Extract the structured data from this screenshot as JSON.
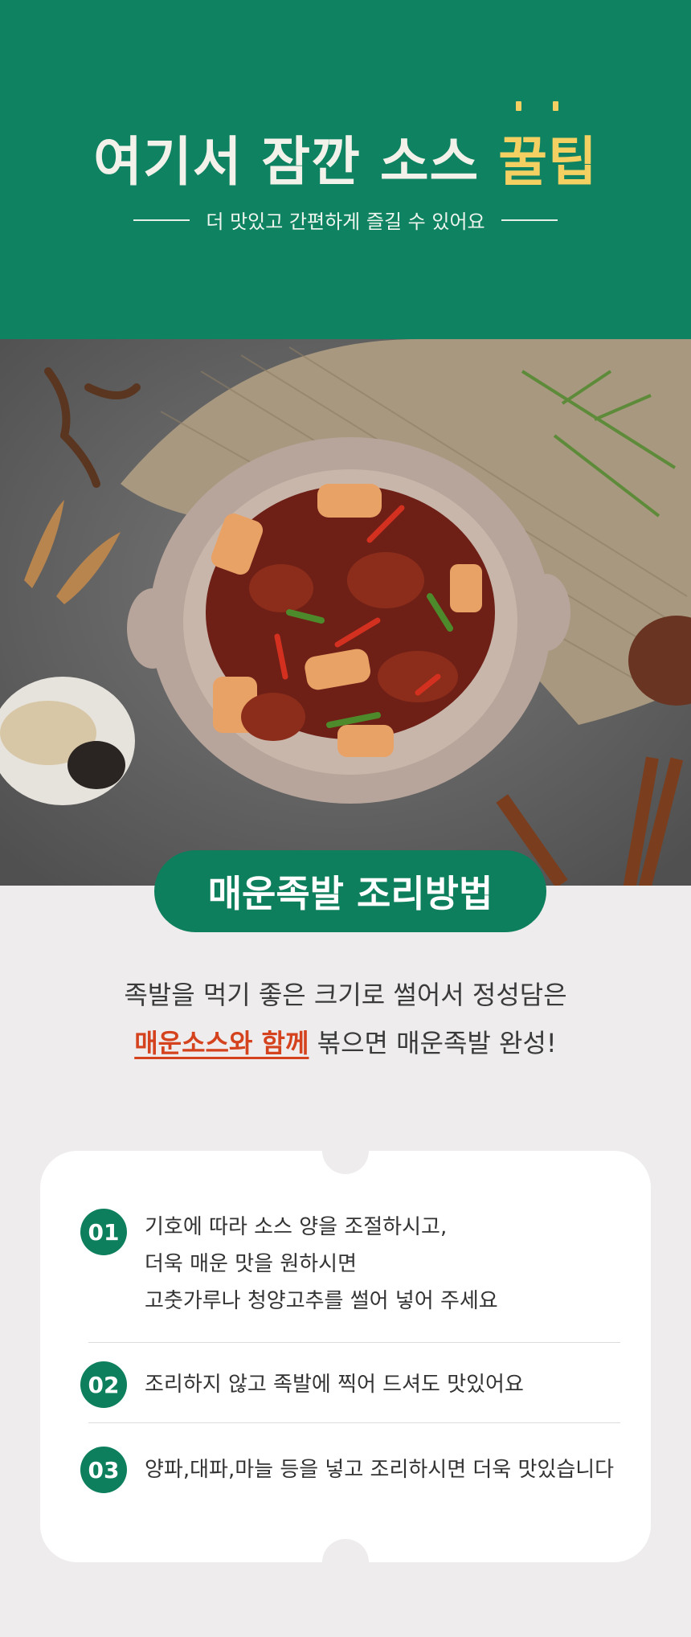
{
  "header": {
    "title_main": "여기서 잠깐 소스 ",
    "title_highlight": "꿀팁",
    "subtitle": "더 맛있고 간편하게 즐길 수 있어요",
    "colors": {
      "background": "#0f8361",
      "highlight": "#f4cf62"
    }
  },
  "photo": {
    "icon": "spicy-jokbal-dish-photo"
  },
  "section_title": "매운족발 조리방법",
  "description": {
    "line1": "족발을 먹기 좋은 크기로 썰어서 정성담은",
    "line2_highlight": "매운소스와 함께",
    "line2_rest": " 볶으면 매운족발 완성!",
    "colors": {
      "highlight": "#d5421e"
    }
  },
  "steps": [
    {
      "number": "01",
      "lines": [
        "기호에 따라 소스 양을 조절하시고,",
        "더욱 매운 맛을 원하시면",
        "고춧가루나 청양고추를 썰어 넣어 주세요"
      ]
    },
    {
      "number": "02",
      "lines": [
        "조리하지 않고 족발에 찍어 드셔도 맛있어요"
      ]
    },
    {
      "number": "03",
      "lines": [
        "양파,대파,마늘 등을 넣고 조리하시면 더욱 맛있습니다"
      ]
    }
  ]
}
